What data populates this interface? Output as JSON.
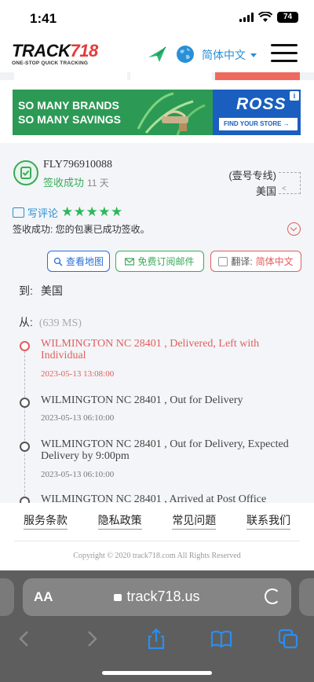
{
  "status_bar": {
    "time": "1:41",
    "battery": "74"
  },
  "header": {
    "logo_text_main": "TRACK",
    "logo_text_num": "718",
    "logo_tagline": "ONE-STOP QUICK TRACKING",
    "language": "简体中文"
  },
  "ad": {
    "headline_line1": "SO MANY BRANDS",
    "headline_line2": "SO MANY SAVINGS",
    "brand": "ROSS",
    "cta": "FIND YOUR STORE →",
    "colors": {
      "left_bg": "#2c9a55",
      "right_bg": "#1a5fbf"
    }
  },
  "package": {
    "tracking_number": "FLY796910088",
    "status": "签收成功",
    "days": "11 天",
    "carrier": "(壹号专线)",
    "destination_country": "美国",
    "review_label": "写评论",
    "stars": "★★★★★",
    "sign_description": "签收成功: 您的包裹已成功签收。"
  },
  "actions": {
    "view_map": "查看地图",
    "subscribe_email": "免费订阅邮件",
    "translate_label": "翻译: ",
    "translate_lang": "简体中文"
  },
  "route": {
    "to_label": "到:",
    "to_value": "美国",
    "from_label": "从:",
    "from_value": "(639 MS)"
  },
  "events": [
    {
      "text": "WILMINGTON NC 28401 , Delivered, Left with Individual",
      "time": "2023-05-13 13:08:00"
    },
    {
      "text": "WILMINGTON NC 28401 , Out for Delivery",
      "time": "2023-05-13 06:10:00"
    },
    {
      "text": "WILMINGTON NC 28401 , Out for Delivery, Expected Delivery by 9:00pm",
      "time": "2023-05-13 06:10:00"
    },
    {
      "text": "WILMINGTON NC 28401 , Arrived at Post Office",
      "time": ""
    }
  ],
  "footer": {
    "links": [
      "服务条款",
      "隐私政策",
      "常见问题",
      "联系我们"
    ],
    "copyright": "Copyright © 2020 track718.com All Rights Reserved"
  },
  "browser": {
    "aa": "AA",
    "url": "track718.us"
  }
}
